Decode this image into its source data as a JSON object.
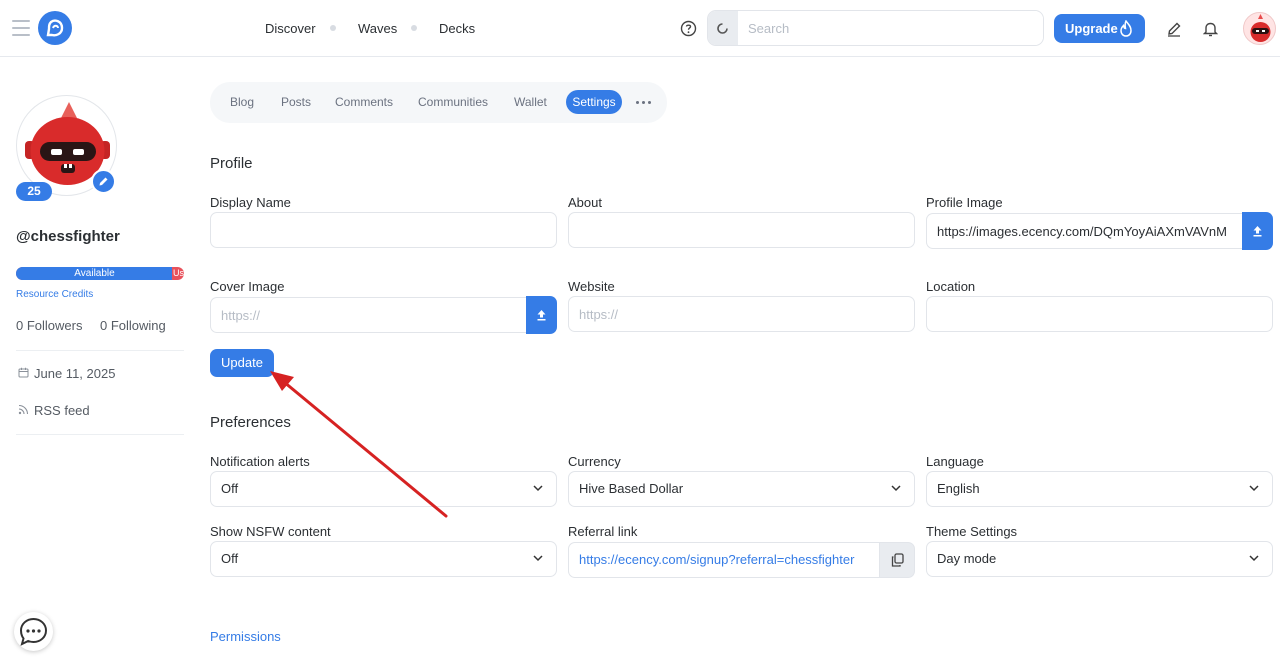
{
  "topbar": {
    "nav": [
      "Discover",
      "Waves",
      "Decks"
    ],
    "search_placeholder": "Search",
    "upgrade_label": "Upgrade"
  },
  "sidebar": {
    "reputation": "25",
    "username": "@chessfighter",
    "rc_available_label": "Available",
    "rc_used_label": "Use",
    "rc_link": "Resource Credits",
    "followers": "0 Followers",
    "following": "0 Following",
    "join_date": "June 11, 2025",
    "rss": "RSS feed"
  },
  "tabs": {
    "items": [
      "Blog",
      "Posts",
      "Comments",
      "Communities",
      "Wallet"
    ],
    "active": "Settings"
  },
  "profile": {
    "title": "Profile",
    "display_name_label": "Display Name",
    "display_name_value": "",
    "about_label": "About",
    "about_value": "",
    "profile_image_label": "Profile Image",
    "profile_image_value": "https://images.ecency.com/DQmYoyAiAXmVAVnM",
    "cover_image_label": "Cover Image",
    "cover_image_placeholder": "https://",
    "website_label": "Website",
    "website_placeholder": "https://",
    "location_label": "Location",
    "location_value": "",
    "update_label": "Update"
  },
  "preferences": {
    "title": "Preferences",
    "notification_label": "Notification alerts",
    "notification_value": "Off",
    "currency_label": "Currency",
    "currency_value": "Hive Based Dollar",
    "language_label": "Language",
    "language_value": "English",
    "nsfw_label": "Show NSFW content",
    "nsfw_value": "Off",
    "referral_label": "Referral link",
    "referral_value": "https://ecency.com/signup?referral=chessfighter",
    "theme_label": "Theme Settings",
    "theme_value": "Day mode"
  },
  "permissions_label": "Permissions",
  "colors": {
    "accent": "#357ce6",
    "danger": "#e8515b",
    "annotation_arrow": "#d62222"
  },
  "resource_credits_available_fraction": 0.93
}
